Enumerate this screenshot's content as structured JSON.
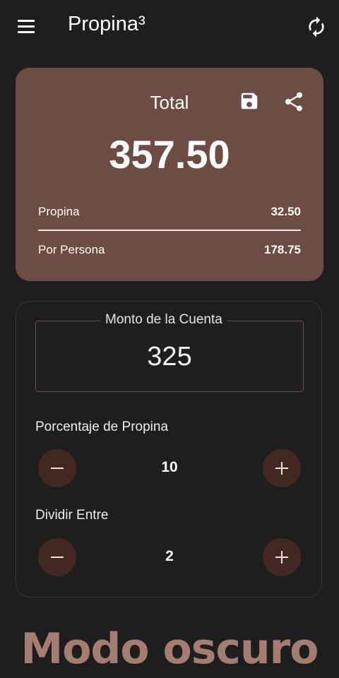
{
  "app_bar": {
    "title": "Propina³",
    "menu_icon": "menu-icon",
    "refresh_icon": "refresh-icon"
  },
  "summary": {
    "total_label": "Total",
    "total_value": "357.50",
    "save_icon": "save-icon",
    "share_icon": "share-icon",
    "tip_label": "Propina",
    "tip_value": "32.50",
    "per_person_label": "Por Persona",
    "per_person_value": "178.75"
  },
  "form": {
    "bill_label": "Monto de la Cuenta",
    "bill_value": "325",
    "tip_percent_label": "Porcentaje de Propina",
    "tip_percent_value": "10",
    "split_label": "Dividir Entre",
    "split_value": "2",
    "decrement_icon": "minus-icon",
    "increment_icon": "plus-icon"
  },
  "caption": "Modo oscuro",
  "colors": {
    "background": "#1e1e1e",
    "card": "#6d4c43",
    "button": "#432722",
    "caption": "#a57c70"
  }
}
